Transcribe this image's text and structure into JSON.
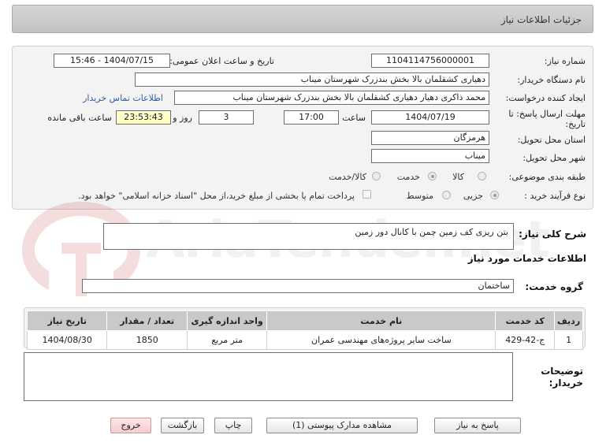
{
  "header": {
    "title": "جزئیات اطلاعات نیاز"
  },
  "form": {
    "need_number_label": "شماره نیاز:",
    "need_number": "1104114756000001",
    "announce_label": "تاریخ و ساعت اعلان عمومی:",
    "announce_value": "1404/07/15 - 15:46",
    "buyer_org_label": "نام دستگاه خریدار:",
    "buyer_org": "دهیاری کشقلمان بالا بخش بندزرک شهرستان میناب",
    "creator_label": "ایجاد کننده درخواست:",
    "creator": "محمد ذاکری دهیار دهیاری کشقلمان بالا بخش بندزرک شهرستان میناب",
    "contact_link": "اطلاعات تماس خریدار",
    "deadline_label_1": "مهلت ارسال پاسخ: تا",
    "deadline_label_2": "تاریخ:",
    "deadline_date": "1404/07/19",
    "time_label": "ساعت",
    "deadline_time": "17:00",
    "days": "3",
    "days_label": "روز و",
    "remaining_time": "23:53:43",
    "remaining_label": "ساعت باقی مانده",
    "province_label": "استان محل تحویل:",
    "province": "هرمزگان",
    "city_label": "شهر محل تحویل:",
    "city": "میناب",
    "category_label": "طبقه بندی موضوعی:",
    "category_options": [
      "کالا",
      "خدمت",
      "کالا/خدمت"
    ],
    "category_selected": 1,
    "purchase_type_label": "نوع فرآیند خرید :",
    "purchase_options": [
      "جزیی",
      "متوسط"
    ],
    "purchase_selected": 0,
    "payment_note": "پرداخت تمام یا بخشی از مبلغ خرید،از محل \"اسناد خزانه اسلامی\" خواهد بود."
  },
  "description": {
    "label": "شرح کلی نیاز:",
    "value": "بتن ریزی کف زمین چمن با کانال دور زمین"
  },
  "services": {
    "section_title": "اطلاعات خدمات مورد نیاز",
    "group_label": "گروه خدمت:",
    "group_value": "ساختمان",
    "columns": [
      "ردیف",
      "کد خدمت",
      "نام خدمت",
      "واحد اندازه گیری",
      "تعداد / مقدار",
      "تاریخ نیاز"
    ],
    "rows": [
      {
        "row": "1",
        "code": "ج-42-429",
        "name": "ساخت سایر پروژه‌های مهندسی عمران",
        "unit": "متر مربع",
        "qty": "1850",
        "date": "1404/08/30"
      }
    ]
  },
  "notes": {
    "label_1": "توضیحات",
    "label_2": "خریدار:",
    "value": ""
  },
  "buttons": {
    "reply": "پاسخ به نیاز",
    "attachments": "مشاهده مدارک پیوستی (1)",
    "print": "چاپ",
    "back": "بازگشت",
    "exit": "خروج"
  },
  "watermark": {
    "text": "AriaTender.net"
  },
  "colors": {
    "link": "#2a5db0",
    "remaining_bg": "#ffffc8",
    "exit_button": "#f5cccc",
    "header_bg": "#c9c9c9"
  }
}
